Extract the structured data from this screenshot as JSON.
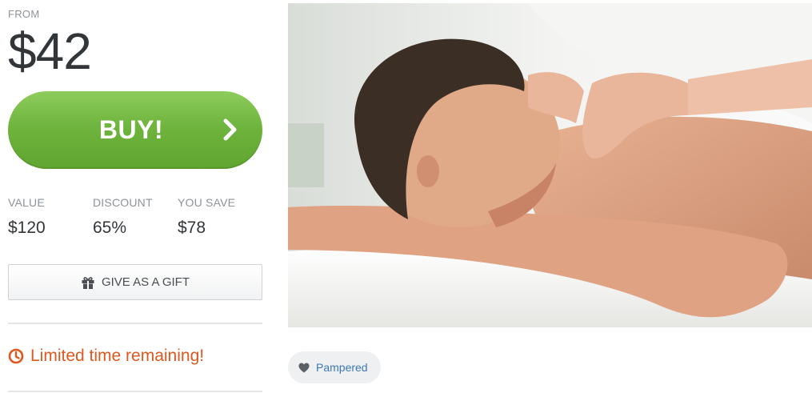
{
  "pricing": {
    "from_label": "FROM",
    "price": "$42"
  },
  "buy_button": {
    "label": "BUY!",
    "color": "#6db33c"
  },
  "stats": [
    {
      "label": "VALUE",
      "value": "$120"
    },
    {
      "label": "DISCOUNT",
      "value": "65%"
    },
    {
      "label": "YOU SAVE",
      "value": "$78"
    }
  ],
  "gift_button": {
    "label": "GIVE AS A GIFT",
    "icon": "gift-icon"
  },
  "timer": {
    "text": "Limited time remaining!",
    "icon": "clock-icon",
    "color": "#e0581e"
  },
  "deal_image": {
    "icon": "massage-photo"
  },
  "tags": [
    {
      "label": "Pampered",
      "icon": "heart-icon"
    }
  ]
}
